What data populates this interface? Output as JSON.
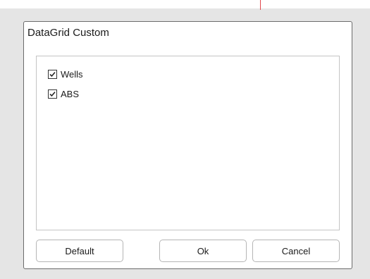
{
  "dialog": {
    "title": "DataGrid Custom",
    "items": [
      {
        "label": "Wells",
        "checked": true
      },
      {
        "label": "ABS",
        "checked": true
      }
    ],
    "buttons": {
      "default_label": "Default",
      "ok_label": "Ok",
      "cancel_label": "Cancel"
    }
  },
  "colors": {
    "background": "#e5e5e5",
    "dialog_border": "#6b6b6b",
    "accent_line": "#e0474c"
  }
}
